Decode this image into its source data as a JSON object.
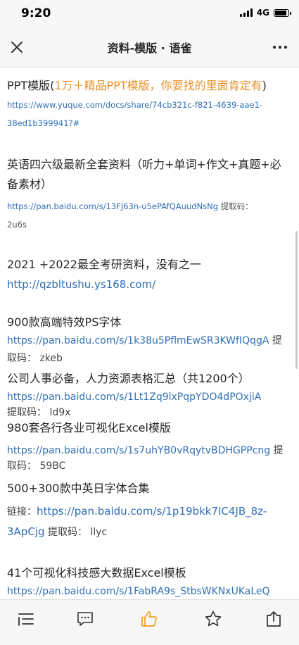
{
  "status_bar": {
    "time": "9:20",
    "network": "4G"
  },
  "nav": {
    "title": "资料-模版 · 语雀",
    "close_icon": "close-icon",
    "more_icon": "more-icon"
  },
  "sections": [
    {
      "heading": "PPT模版(",
      "heading_accent": "1万＋精品PPT模版，你要找的里面肯定有",
      "heading_end": ")",
      "lines": [
        "https://www.yuque.com/docs/share/74cb321c-f821-4639-aae1-",
        "38ed1b399941?#"
      ]
    },
    {
      "heading_line1": "英语四六级最新全套资料（听力+单词+作文+真题+必",
      "heading_line2": "备素材）",
      "link": "https://pan.baidu.com/s/13FJ63n-u5ePAfQAuudNsNg",
      "code_label": " 提取码：",
      "code": "2u6s"
    },
    {
      "heading": "2021 +2022最全考研资料，没有之一",
      "link": "http://qzbltushu.ys168.com/"
    },
    {
      "heading": "900款高端特效PS字体",
      "link": "https://pan.baidu.com/s/1k38u5PflmEwSR3KWfIQqgA",
      "tail": " 提",
      "line2": "取码：  zkeb"
    },
    {
      "heading": "公司人事必备，人力资源表格汇总（共1200个）",
      "link": "https://pan.baidu.com/s/1Lt1Zq9lxPqpYDO4dPOxjiA",
      "line2": "提取码：  ld9x"
    },
    {
      "heading": "980套各行各业可视化Excel模版",
      "link": "https://pan.baidu.com/s/1s7uhYB0vRqytvBDHGPPcng",
      "tail": " 提",
      "line2": "取码：  59BC"
    },
    {
      "heading": "500+300款中英日字体合集",
      "prefix": "链接：",
      "link_line1": "https://pan.baidu.com/s/1p19bkk7IC4JB_8z-",
      "link_line2": "3ApCjg",
      "code_text": "  提取码：  llyc"
    },
    {
      "heading": "41个可视化科技感大数据Excel模板",
      "link": "https://pan.baidu.com/s/1FabRA9s_StbsWKNxUKaLeQ"
    }
  ],
  "bottom_bar": {
    "icons": [
      "toc-icon",
      "comment-icon",
      "like-icon",
      "star-icon",
      "share-icon"
    ],
    "accent_color": "#f0a020"
  }
}
